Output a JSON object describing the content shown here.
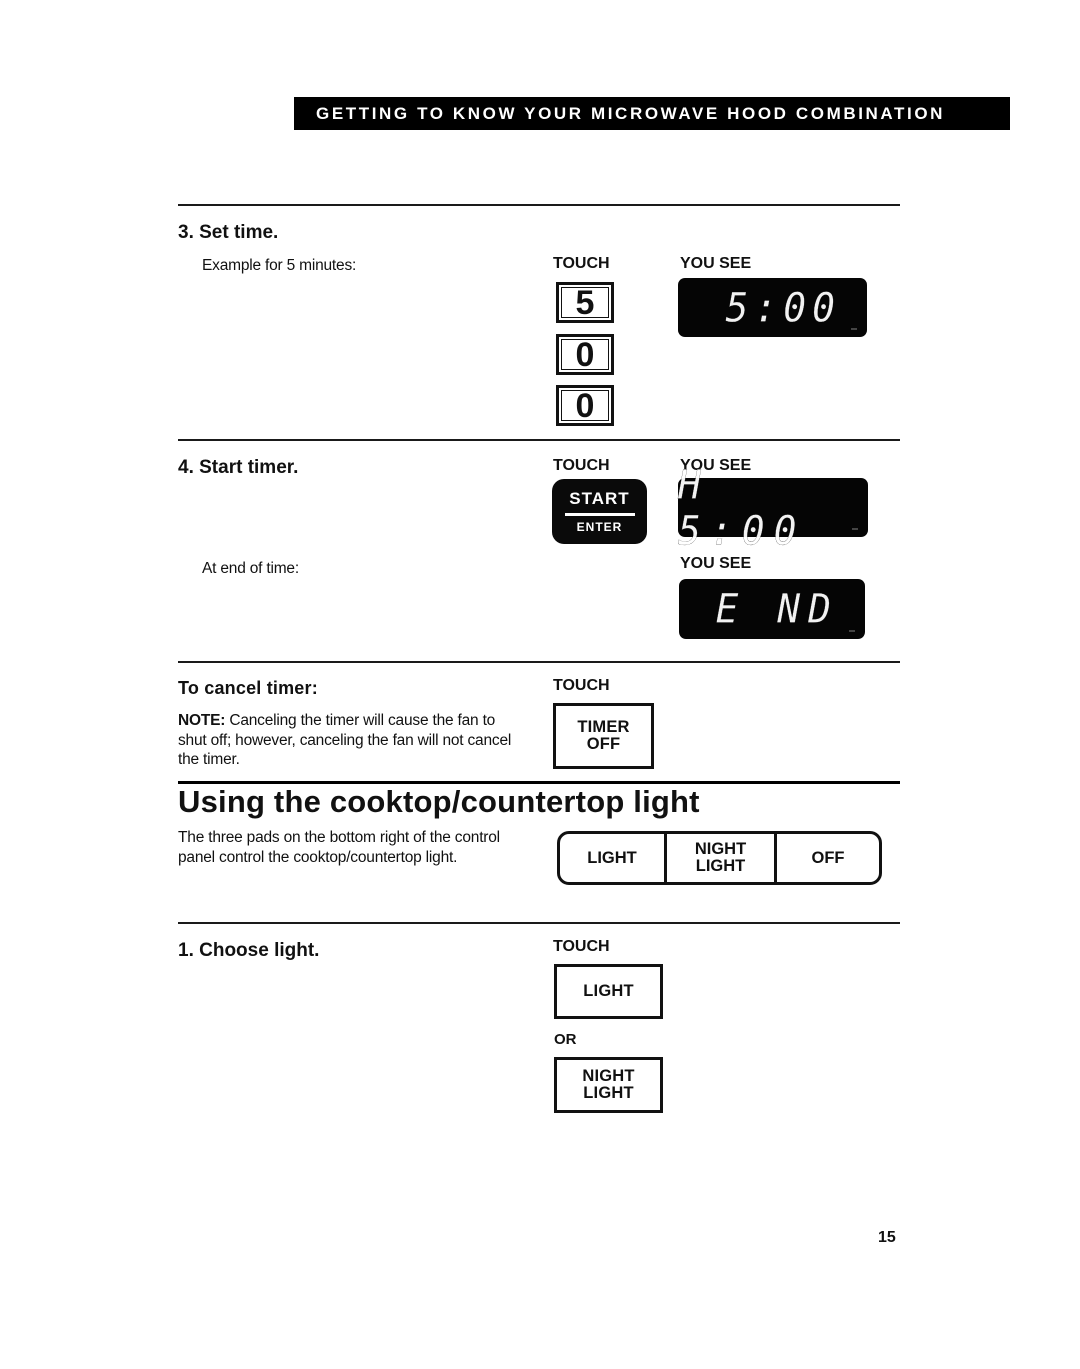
{
  "banner": {
    "title": "GETTING TO KNOW YOUR MICROWAVE HOOD COMBINATION"
  },
  "step3": {
    "title": "3. Set time.",
    "example": "Example for 5 minutes:",
    "touch_label": "TOUCH",
    "you_see_label": "YOU SEE",
    "keys": [
      "5",
      "0",
      "0"
    ],
    "display": "5:00"
  },
  "step4": {
    "title": "4. Start timer.",
    "touch_label": "TOUCH",
    "you_see_label": "YOU SEE",
    "start_button": {
      "top": "START",
      "bottom": "ENTER"
    },
    "display": "H 5:00",
    "end_text": "At end of time:",
    "end_you_see_label": "YOU SEE",
    "end_display": "E ND"
  },
  "cancel": {
    "title": "To cancel timer:",
    "note_label": "NOTE:",
    "note_text": " Canceling the timer will cause the fan to shut off; however, canceling the fan will not cancel the timer.",
    "touch_label": "TOUCH",
    "pad": {
      "line1": "TIMER",
      "line2": "OFF"
    }
  },
  "light_section": {
    "heading": "Using the cooktop/countertop light",
    "description": "The three pads on the bottom right of the control panel control the cooktop/countertop light.",
    "strip": {
      "light": "LIGHT",
      "night_line1": "NIGHT",
      "night_line2": "LIGHT",
      "off": "OFF"
    }
  },
  "step1": {
    "title": "1. Choose light.",
    "touch_label": "TOUCH",
    "pad_light": "LIGHT",
    "or_label": "OR",
    "pad_night_line1": "NIGHT",
    "pad_night_line2": "LIGHT"
  },
  "page_number": "15"
}
